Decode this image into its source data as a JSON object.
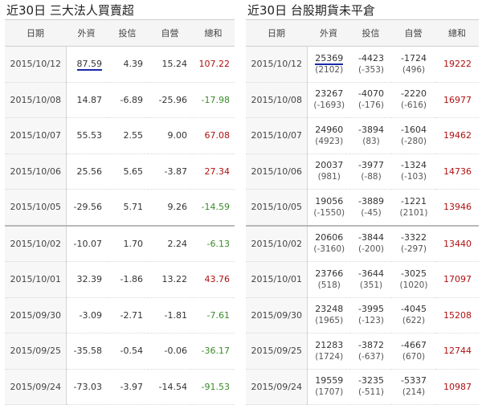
{
  "left": {
    "title": "近30日 三大法人買賣超",
    "headers": [
      "日期",
      "外資",
      "投信",
      "自營",
      "總和"
    ],
    "rows": [
      {
        "date": "2015/10/12",
        "foreign": "87.59",
        "trust": "4.39",
        "dealer": "15.24",
        "total": "107.22"
      },
      {
        "date": "2015/10/08",
        "foreign": "14.87",
        "trust": "-6.89",
        "dealer": "-25.96",
        "total": "-17.98"
      },
      {
        "date": "2015/10/07",
        "foreign": "55.53",
        "trust": "2.55",
        "dealer": "9.00",
        "total": "67.08"
      },
      {
        "date": "2015/10/06",
        "foreign": "25.56",
        "trust": "5.65",
        "dealer": "-3.87",
        "total": "27.34"
      },
      {
        "date": "2015/10/05",
        "foreign": "-29.56",
        "trust": "5.71",
        "dealer": "9.26",
        "total": "-14.59"
      },
      {
        "date": "2015/10/02",
        "foreign": "-10.07",
        "trust": "1.70",
        "dealer": "2.24",
        "total": "-6.13"
      },
      {
        "date": "2015/10/01",
        "foreign": "32.39",
        "trust": "-1.86",
        "dealer": "13.22",
        "total": "43.76"
      },
      {
        "date": "2015/09/30",
        "foreign": "-3.09",
        "trust": "-2.71",
        "dealer": "-1.81",
        "total": "-7.61"
      },
      {
        "date": "2015/09/25",
        "foreign": "-35.58",
        "trust": "-0.54",
        "dealer": "-0.06",
        "total": "-36.17"
      },
      {
        "date": "2015/09/24",
        "foreign": "-73.03",
        "trust": "-3.97",
        "dealer": "-14.54",
        "total": "-91.53"
      }
    ]
  },
  "right": {
    "title": "近30日 台股期貨未平倉",
    "headers": [
      "日期",
      "外資",
      "投信",
      "自營",
      "總和"
    ],
    "rows": [
      {
        "date": "2015/10/12",
        "foreign": "25369",
        "foreign_chg": "(2102)",
        "trust": "-4423",
        "trust_chg": "(-353)",
        "dealer": "-1724",
        "dealer_chg": "(496)",
        "total": "19222"
      },
      {
        "date": "2015/10/08",
        "foreign": "23267",
        "foreign_chg": "(-1693)",
        "trust": "-4070",
        "trust_chg": "(-176)",
        "dealer": "-2220",
        "dealer_chg": "(-616)",
        "total": "16977"
      },
      {
        "date": "2015/10/07",
        "foreign": "24960",
        "foreign_chg": "(4923)",
        "trust": "-3894",
        "trust_chg": "(83)",
        "dealer": "-1604",
        "dealer_chg": "(-280)",
        "total": "19462"
      },
      {
        "date": "2015/10/06",
        "foreign": "20037",
        "foreign_chg": "(981)",
        "trust": "-3977",
        "trust_chg": "(-88)",
        "dealer": "-1324",
        "dealer_chg": "(-103)",
        "total": "14736"
      },
      {
        "date": "2015/10/05",
        "foreign": "19056",
        "foreign_chg": "(-1550)",
        "trust": "-3889",
        "trust_chg": "(-45)",
        "dealer": "-1221",
        "dealer_chg": "(2101)",
        "total": "13946"
      },
      {
        "date": "2015/10/02",
        "foreign": "20606",
        "foreign_chg": "(-3160)",
        "trust": "-3844",
        "trust_chg": "(-200)",
        "dealer": "-3322",
        "dealer_chg": "(-297)",
        "total": "13440"
      },
      {
        "date": "2015/10/01",
        "foreign": "23766",
        "foreign_chg": "(518)",
        "trust": "-3644",
        "trust_chg": "(351)",
        "dealer": "-3025",
        "dealer_chg": "(1020)",
        "total": "17097"
      },
      {
        "date": "2015/09/30",
        "foreign": "23248",
        "foreign_chg": "(1965)",
        "trust": "-3995",
        "trust_chg": "(-123)",
        "dealer": "-4045",
        "dealer_chg": "(622)",
        "total": "15208"
      },
      {
        "date": "2015/09/25",
        "foreign": "21283",
        "foreign_chg": "(1724)",
        "trust": "-3872",
        "trust_chg": "(-637)",
        "dealer": "-4667",
        "dealer_chg": "(670)",
        "total": "12744"
      },
      {
        "date": "2015/09/24",
        "foreign": "19559",
        "foreign_chg": "(1707)",
        "trust": "-3235",
        "trust_chg": "(-511)",
        "dealer": "-5337",
        "dealer_chg": "(214)",
        "total": "10987"
      }
    ]
  },
  "colors": {
    "positive": "#b01010",
    "negative": "#3a8a2a",
    "highlight": "#1a28a8"
  }
}
